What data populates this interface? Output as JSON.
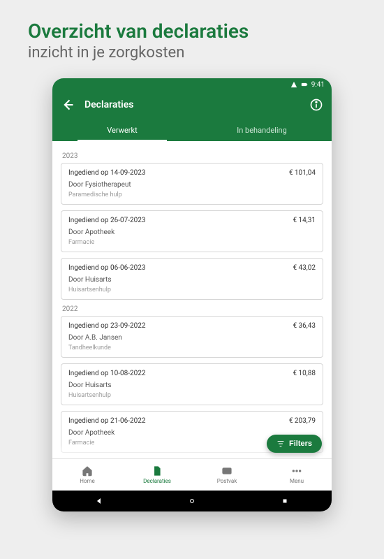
{
  "promo": {
    "title": "Overzicht van declaraties",
    "subtitle": "inzicht in je zorgkosten"
  },
  "status": {
    "time": "9:41"
  },
  "header": {
    "title": "Declaraties"
  },
  "tabs": [
    {
      "label": "Verwerkt",
      "active": true
    },
    {
      "label": "In behandeling",
      "active": false
    }
  ],
  "groups": [
    {
      "year": "2023",
      "items": [
        {
          "submitted": "Ingediend op 14-09-2023",
          "by": "Door Fysiotherapeut",
          "category": "Paramedische hulp",
          "amount": "€ 101,04"
        },
        {
          "submitted": "Ingediend op 26-07-2023",
          "by": "Door Apotheek",
          "category": "Farmacie",
          "amount": "€ 14,31"
        },
        {
          "submitted": "Ingediend op 06-06-2023",
          "by": "Door Huisarts",
          "category": "Huisartsenhulp",
          "amount": "€ 43,02"
        }
      ]
    },
    {
      "year": "2022",
      "items": [
        {
          "submitted": "Ingediend op 23-09-2022",
          "by": "Door A.B. Jansen",
          "category": "Tandheelkunde",
          "amount": "€ 36,43"
        },
        {
          "submitted": "Ingediend op 10-08-2022",
          "by": "Door Huisarts",
          "category": "Huisartsenhulp",
          "amount": "€ 10,88"
        },
        {
          "submitted": "Ingediend op 21-06-2022",
          "by": "Door Apotheek",
          "category": "Farmacie",
          "amount": "€ 203,79"
        }
      ]
    }
  ],
  "filters": {
    "label": "Filters"
  },
  "bottomNav": [
    {
      "label": "Home",
      "icon": "home",
      "active": false
    },
    {
      "label": "Declaraties",
      "icon": "document",
      "active": true
    },
    {
      "label": "Postvak",
      "icon": "mail",
      "active": false
    },
    {
      "label": "Menu",
      "icon": "dots",
      "active": false
    }
  ]
}
